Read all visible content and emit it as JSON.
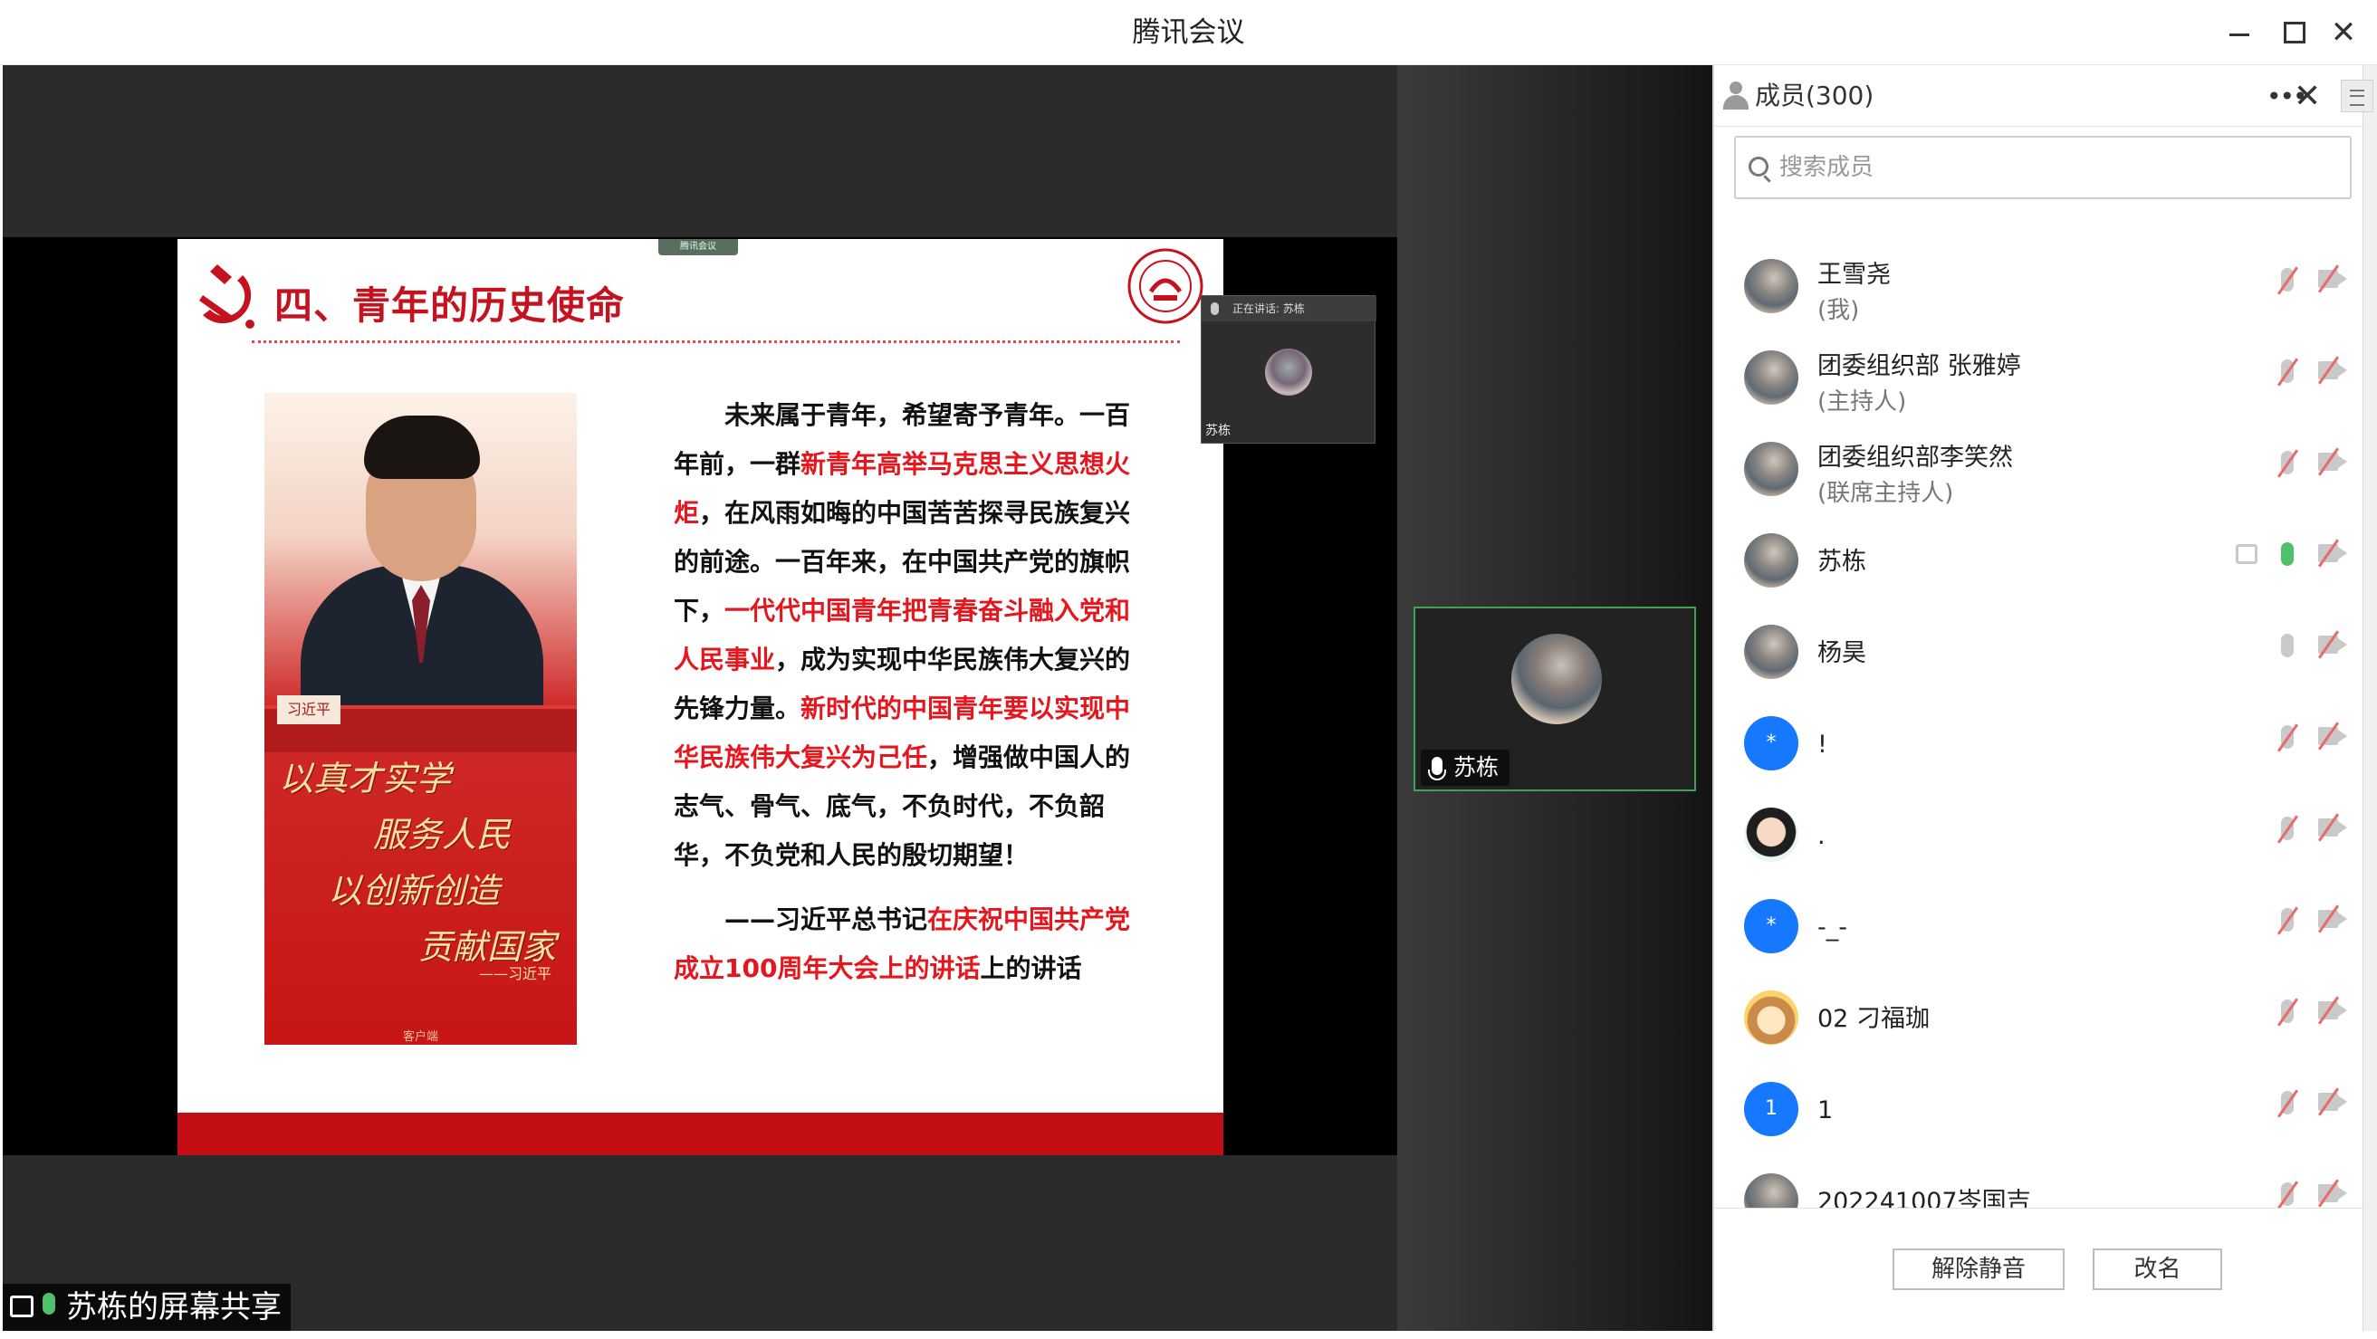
{
  "app": {
    "title": "腾讯会议"
  },
  "share": {
    "slide": {
      "tag": "腾讯会议",
      "title": "四、青年的历史使命",
      "nameplate": "习近平",
      "calligraphy": [
        "以真才实学",
        "服务人民",
        "以创新创造",
        "贡献国家"
      ],
      "calligraphy_sign": "——习近平",
      "portrait_footer": "客户端",
      "para": [
        {
          "t": "未来属于青年，希望寄予青年。一百年前，一群",
          "red": false
        },
        {
          "t": "新青年高举马克思主义思想火炬",
          "red": true
        },
        {
          "t": "，在风雨如晦的中国苦苦探寻民族复兴的前途。一百年来，在中国共产党的旗帜下，",
          "red": false
        },
        {
          "t": "一代代中国青年把青春奋斗融入党和人民事业",
          "red": true
        },
        {
          "t": "，成为实现中华民族伟大复兴的先锋力量。",
          "red": false
        },
        {
          "t": "新时代的中国青年要以实现中华民族伟大复兴为己任",
          "red": true
        },
        {
          "t": "，增强做中国人的志气、骨气、底气，不负时代，不负韶华，不负党和人民的殷切期望！",
          "red": false
        }
      ],
      "quote": [
        {
          "t": "——习近平总书记",
          "red": false
        },
        {
          "t": "在庆祝中国共产党成立100周年大会上的讲话",
          "red": true
        },
        {
          "t": "上的讲话",
          "red": false
        }
      ]
    },
    "mini_view": {
      "header": "正在讲话: 苏栋",
      "name": "苏栋"
    },
    "label": "苏栋的屏幕共享"
  },
  "video_tile": {
    "name": "苏栋"
  },
  "members_panel": {
    "title": "成员(300)",
    "search_placeholder": "搜索成员",
    "members": [
      {
        "name": "王雪尧",
        "role": "(我)",
        "avatar": "photo",
        "mic": "off",
        "share": false
      },
      {
        "name": "团委组织部 张雅婷",
        "role": "(主持人)",
        "avatar": "photo",
        "mic": "off",
        "share": false
      },
      {
        "name": "团委组织部李笑然",
        "role": "(联席主持人)",
        "avatar": "photo",
        "mic": "off",
        "share": false
      },
      {
        "name": "苏栋",
        "role": "",
        "avatar": "photo",
        "mic": "on",
        "share": true
      },
      {
        "name": "杨昊",
        "role": "",
        "avatar": "photo",
        "mic": "idle",
        "share": false
      },
      {
        "name": "!",
        "role": "",
        "avatar": "blue",
        "avatar_text": "*",
        "mic": "off",
        "share": false
      },
      {
        "name": ".",
        "role": "",
        "avatar": "cartoon",
        "mic": "off",
        "share": false
      },
      {
        "name": "-_-",
        "role": "",
        "avatar": "blue",
        "avatar_text": "*",
        "mic": "off",
        "share": false
      },
      {
        "name": "02 刁福珈",
        "role": "",
        "avatar": "cartoon2",
        "mic": "off",
        "share": false
      },
      {
        "name": "1",
        "role": "",
        "avatar": "blue",
        "avatar_text": "1",
        "mic": "off",
        "share": false
      },
      {
        "name": "202241007岑国吉",
        "role": "",
        "avatar": "photo",
        "mic": "off",
        "share": false
      }
    ],
    "buttons": {
      "unmute": "解除静音",
      "rename": "改名"
    }
  }
}
